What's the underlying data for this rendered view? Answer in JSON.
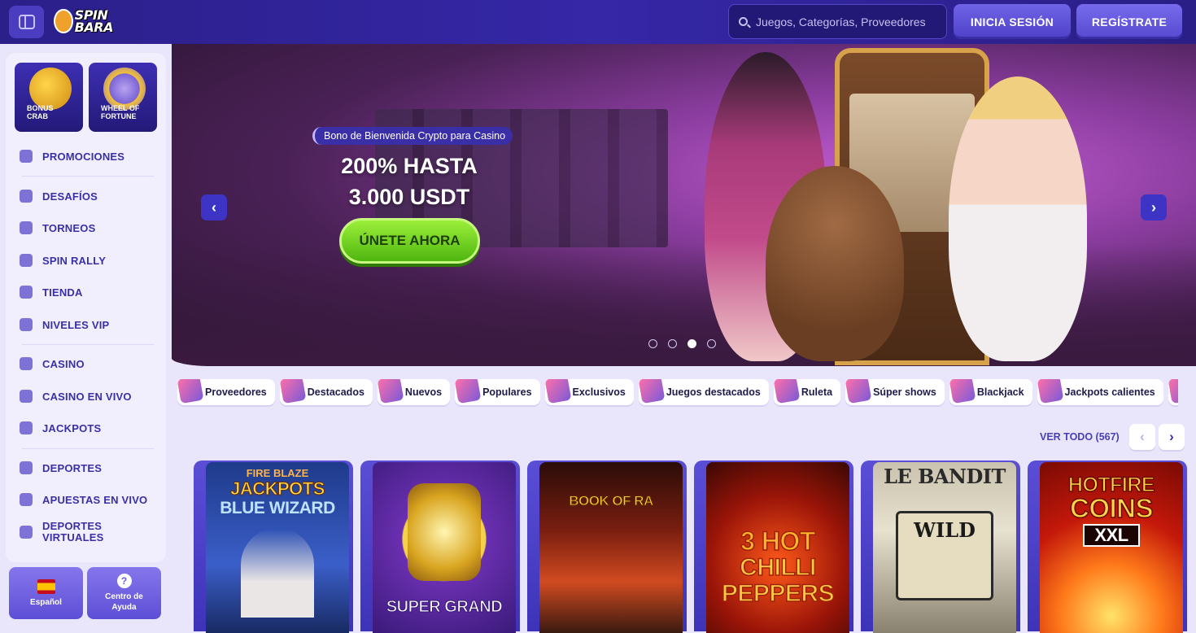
{
  "header": {
    "logo_text": "SPIN BARA",
    "search_placeholder": "Juegos, Categorías, Proveedores",
    "login_label": "INICIA SESIÓN",
    "register_label": "REGÍSTRATE"
  },
  "sidebar": {
    "tiles": [
      {
        "label_line1": "BONUS",
        "label_line2": "CRAB"
      },
      {
        "label_line1": "WHEEL OF",
        "label_line2": "FORTUNE"
      }
    ],
    "items": [
      {
        "label": "PROMOCIONES"
      },
      {
        "label": "DESAFÍOS"
      },
      {
        "label": "TORNEOS"
      },
      {
        "label": "SPIN RALLY"
      },
      {
        "label": "TIENDA"
      },
      {
        "label": "NIVELES VIP"
      },
      {
        "label": "CASINO"
      },
      {
        "label": "CASINO EN VIVO"
      },
      {
        "label": "JACKPOTS"
      },
      {
        "label": "DEPORTES"
      },
      {
        "label": "APUESTAS EN VIVO"
      },
      {
        "label_line1": "DEPORTES",
        "label_line2": "VIRTUALES"
      }
    ],
    "language_label": "Español",
    "help_line1": "Centro de",
    "help_line2": "Ayuda",
    "help_icon": "?"
  },
  "hero": {
    "tag": "Bono de Bienvenida Crypto para Casino",
    "title_line1": "200% HASTA",
    "title_line2": "3.000 USDT",
    "cta_label": "ÚNETE AHORA",
    "prev_icon": "‹",
    "next_icon": "›",
    "slide_count": 4,
    "active_slide": 3
  },
  "categories": [
    "Proveedores",
    "Destacados",
    "Nuevos",
    "Populares",
    "Exclusivos",
    "Juegos destacados",
    "Ruleta",
    "Súper shows",
    "Blackjack",
    "Jackpots calientes"
  ],
  "games_section": {
    "view_all_label": "VER TODO (567)",
    "prev_icon": "‹",
    "next_icon": "›"
  },
  "games": [
    {
      "title_line1": "FIRE BLAZE",
      "title_line2": "JACKPOTS",
      "title_line3": "BLUE WIZARD"
    },
    {
      "title_line1": "",
      "title_line2": "",
      "title_line3": "SUPER GRAND"
    },
    {
      "title_line1": "BOOK OF RA",
      "title_line2": "",
      "title_line3": ""
    },
    {
      "title_line1": "3 HOT",
      "title_line2": "CHILLI",
      "title_line3": "PEPPERS"
    },
    {
      "title_line1": "LE BANDIT",
      "title_line2": "WILD",
      "title_line3": ""
    },
    {
      "title_line1": "HOTFIRE",
      "title_line2": "COINS",
      "title_line3": "XXL"
    }
  ]
}
